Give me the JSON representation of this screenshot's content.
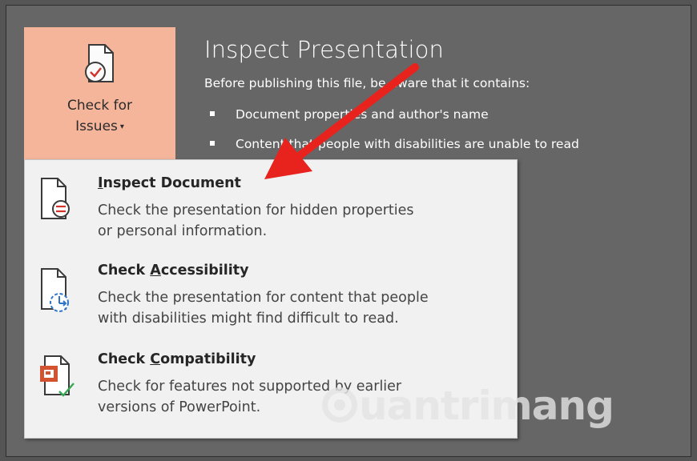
{
  "ribbon": {
    "button_line1": "Check for",
    "button_line2": "Issues",
    "caret": "▾"
  },
  "info": {
    "title": "Inspect Presentation",
    "intro": "Before publishing this file, be aware that it contains:",
    "bullets": [
      "Document properties and author's name",
      "Content that people with disabilities are unable to read"
    ]
  },
  "menu": {
    "items": [
      {
        "icon": "inspect-document-icon",
        "title_prefix": "",
        "title_accel": "I",
        "title_rest": "nspect Document",
        "desc_line1": "Check the presentation for hidden properties",
        "desc_line2": "or personal information."
      },
      {
        "icon": "check-accessibility-icon",
        "title_prefix": "Check ",
        "title_accel": "A",
        "title_rest": "ccessibility",
        "desc_line1": "Check the presentation for content that people",
        "desc_line2": "with disabilities might find difficult to read."
      },
      {
        "icon": "check-compatibility-icon",
        "title_prefix": "Check ",
        "title_accel": "C",
        "title_rest": "ompatibility",
        "desc_line1": "Check for features not supported by earlier",
        "desc_line2": "versions of PowerPoint."
      }
    ]
  },
  "annotation": {
    "arrow_color": "#e8231d"
  },
  "watermark": {
    "text": "uantrimang"
  },
  "colors": {
    "background": "#555555",
    "ribbon_button": "#f4b59b",
    "menu_background": "#f1f1f1",
    "accent_red": "#e03a2f"
  }
}
